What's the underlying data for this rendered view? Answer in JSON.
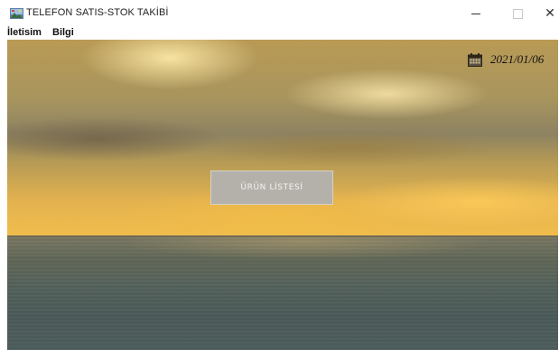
{
  "window": {
    "title": "TELEFON SATIS-STOK TAKİBİ",
    "app_icon": "java-app-icon",
    "controls": {
      "minimize": "minimize-icon",
      "maximize": "maximize-icon",
      "close": "close-icon",
      "close_glyph": "✕"
    }
  },
  "menubar": {
    "items": [
      {
        "label": "İletisim"
      },
      {
        "label": "Bilgi"
      }
    ]
  },
  "main": {
    "date": "2021/01/06",
    "date_icon": "calendar-icon",
    "product_list_button": "ÜRÜN LİSTESİ"
  },
  "colors": {
    "button_bg": "#b4b1aa",
    "button_text": "#f4f4f4"
  }
}
